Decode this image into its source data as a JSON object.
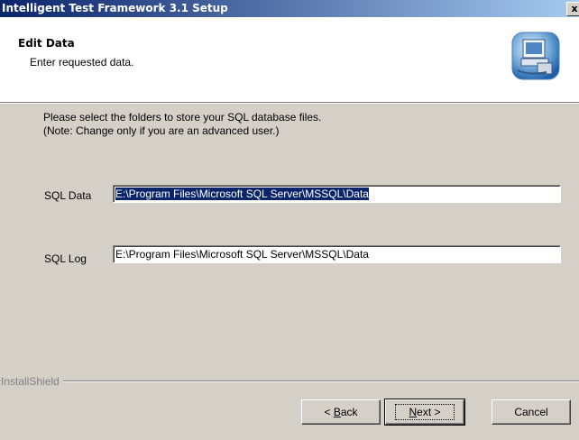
{
  "window": {
    "title": "Intelligent Test Framework 3.1 Setup",
    "close_glyph": "x"
  },
  "header": {
    "title": "Edit Data",
    "subtitle": "Enter requested data.",
    "icon": "setup-computer-icon"
  },
  "instructions": {
    "line1": "Please select the folders to store your SQL database files.",
    "line2": "(Note: Change only if you are an advanced user.)"
  },
  "fields": {
    "sql_data": {
      "label": "SQL Data",
      "value": "E:\\Program Files\\Microsoft SQL Server\\MSSQL\\Data",
      "selected": true
    },
    "sql_log": {
      "label": "SQL Log",
      "value": "E:\\Program Files\\Microsoft SQL Server\\MSSQL\\Data",
      "selected": false
    }
  },
  "footer": {
    "brand": "InstallShield",
    "back": {
      "pre": "< ",
      "accel": "B",
      "post": "ack"
    },
    "next": {
      "accel": "N",
      "post": "ext >"
    },
    "cancel": "Cancel"
  },
  "colors": {
    "titlebar_start": "#0a246a",
    "titlebar_end": "#a6caf0",
    "face": "#d4d0c8",
    "selection": "#0a246a"
  }
}
